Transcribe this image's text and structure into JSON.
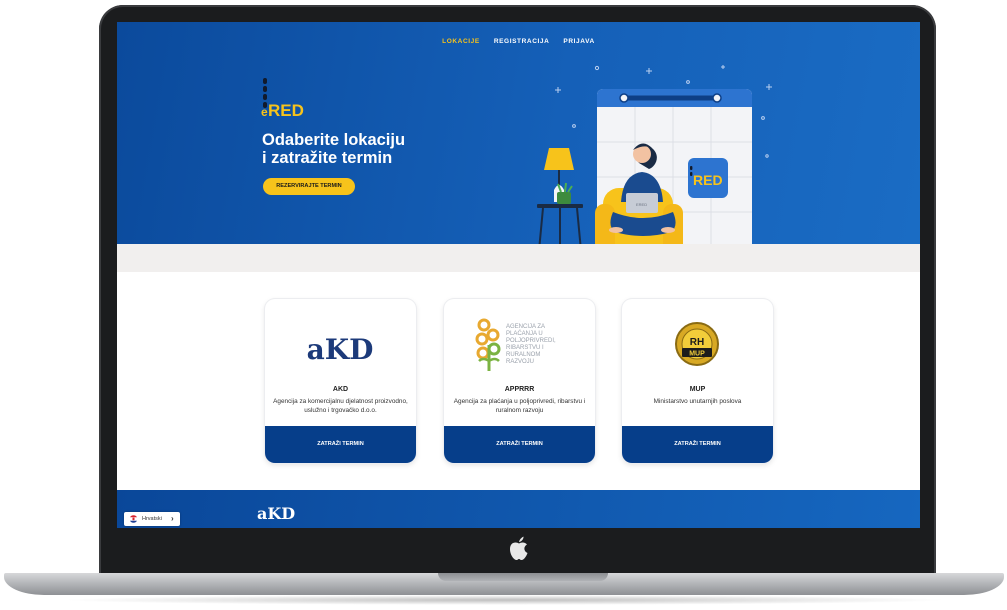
{
  "nav": {
    "items": [
      {
        "label": "LOKACIJE",
        "active": true
      },
      {
        "label": "REGISTRACIJA",
        "active": false
      },
      {
        "label": "PRIJAVA",
        "active": false
      }
    ]
  },
  "hero": {
    "logo_text": "RED",
    "title": "Odaberite lokaciju\ni zatražite termin",
    "button_label": "REZERVIRAJTE TERMIN",
    "illustration_badge": "RED",
    "laptop_label": "ERED"
  },
  "cards": [
    {
      "logo_text": "aKD",
      "title": "AKD",
      "description": "Agencija za komercijalnu djelatnost proizvodno, uslužno i trgovačko d.o.o.",
      "button_label": "ZATRAŽI TERMIN"
    },
    {
      "logo_lines": [
        "AGENCIJA ZA",
        "PLAĆANJA U",
        "POLJOPRIVREDI,",
        "RIBARSTVU I",
        "RURALNOM",
        "RAZVOJU"
      ],
      "title": "APPRRR",
      "description": "Agencija za plaćanja u poljoprivredi, ribarstvu i ruralnom razvoju",
      "button_label": "ZATRAŽI TERMIN"
    },
    {
      "logo_text_top": "RH",
      "logo_text_bottom": "MUP",
      "title": "MUP",
      "description": "Ministarstvo unutarnjih poslova",
      "button_label": "ZATRAŽI TERMIN"
    }
  ],
  "footer": {
    "logo_text": "aKD"
  },
  "language": {
    "label": "Hrvatski",
    "chevron": "›",
    "flag_icon": "croatia-flag-icon"
  },
  "colors": {
    "primary_blue": "#0b4a9c",
    "accent_yellow": "#f7c31b",
    "button_blue": "#063e8a"
  }
}
